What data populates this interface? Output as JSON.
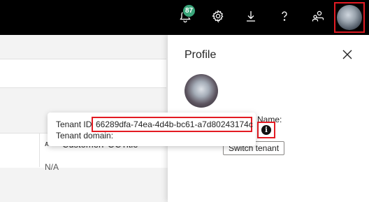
{
  "topbar": {
    "notification_count": "87",
    "icons": [
      "bell-icon",
      "gear-icon",
      "download-icon",
      "help-icon",
      "people-icon"
    ]
  },
  "table": {
    "column_type_icon": "ABC",
    "column_title": "CustomerPOCTitle",
    "cell_value": "N/A"
  },
  "profile": {
    "title": "Profile",
    "name_label": "Name:",
    "info_icon": "i",
    "switch_tenant_label": "Switch tenant"
  },
  "tooltip": {
    "tenant_id_label": "Tenant ID:",
    "tenant_id_value": "66289dfa-74ea-4d4b-bc61-a7d80243174c",
    "tenant_domain_label": "Tenant domain:"
  },
  "colors": {
    "highlight": "#e31b23",
    "badge": "#3aa57a",
    "topbar": "#000000"
  }
}
